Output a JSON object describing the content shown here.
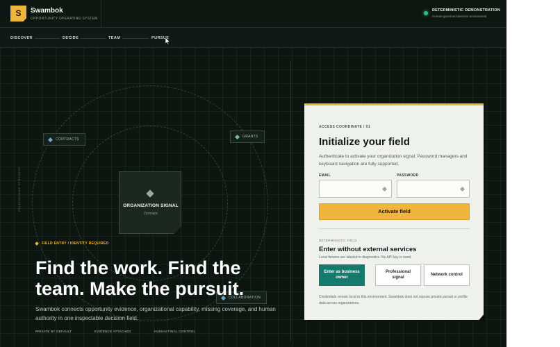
{
  "brand": {
    "logo_letter": "S",
    "name": "Swambok",
    "tagline": "OPPORTUNITY OPERATING SYSTEM"
  },
  "status": {
    "title": "DETERMINISTIC DEMONSTRATION",
    "subtitle": "Human-governed decision environment",
    "color": "#2ebf7d"
  },
  "nav": {
    "items": [
      "DISCOVER",
      "DECIDE",
      "TEAM",
      "PURSUE"
    ]
  },
  "map": {
    "side_label": "RELATIONSHIP STRENGTH",
    "nodes": {
      "contracts": "CONTRACTS",
      "grants": "GRANTS",
      "collaboration": "COLLABORATION"
    },
    "org_title": "ORGANIZATION SIGNAL",
    "org_state": "Dormant"
  },
  "hero": {
    "eyebrow": "FIELD ENTRY / IDENTITY REQUIRED",
    "title": "Find the work. Find the team. Make the pursuit.",
    "description": "Swambok connects opportunity evidence, organizational capability, missing coverage, and human authority in one inspectable decision field.",
    "meta": [
      "PRIVATE BY DEFAULT",
      "EVIDENCE ATTACHED",
      "HUMAN FINAL CONTROL"
    ]
  },
  "card": {
    "eyebrow": "ACCESS COORDINATE / 01",
    "title": "Initialize your field",
    "description": "Authenticate to activate your organization signal. Password managers and keyboard navigation are fully supported.",
    "email_label": "EMAIL",
    "email_value": "",
    "password_label": "PASSWORD",
    "password_value": "",
    "submit_label": "Activate field",
    "alt_eyebrow": "DETERMINISTIC FIELD",
    "alt_title": "Enter without external services",
    "alt_note": "Local fixtures are labeled in diagnostics. No API key is used.",
    "options": [
      "Enter as business owner",
      "Professional signal",
      "Network control"
    ],
    "footer": "Credentials remain local to this environment. Swambok does not expose private pursuit or profile data across organizations."
  },
  "colors": {
    "accent": "#f0b53d",
    "teal": "#137a6c",
    "background": "#0d1511"
  }
}
